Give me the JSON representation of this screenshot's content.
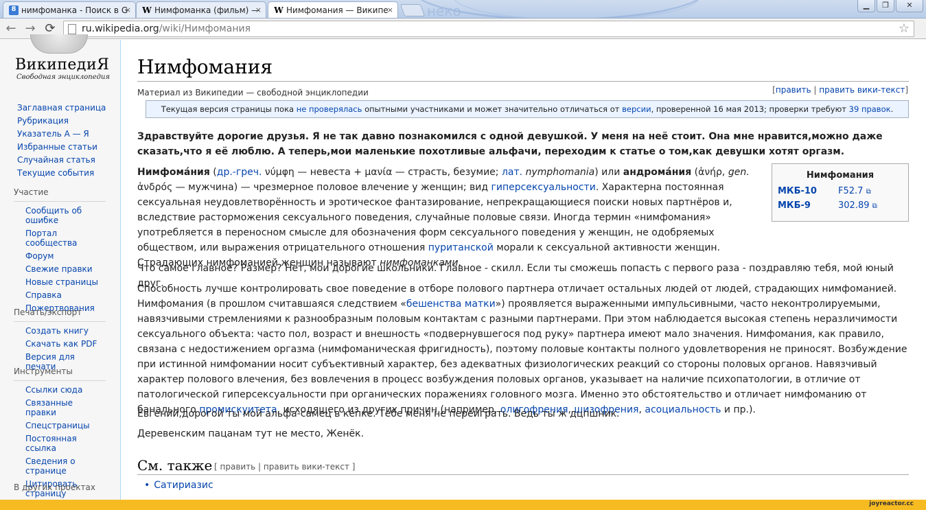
{
  "browser": {
    "tabs": [
      {
        "title": "нимфоманка - Поиск в G",
        "icon": "google-icon"
      },
      {
        "title": "Нимфоманка (фильм) —",
        "icon": "wikipedia-w-icon"
      },
      {
        "title": "Нимфомания — Википе",
        "icon": "wikipedia-w-icon"
      }
    ],
    "tab_icon_letters": {
      "google": "8",
      "wiki": "W"
    },
    "close_glyph": "×",
    "ghost_text": "неко",
    "window_buttons": {
      "minimize": "▁",
      "maximize": "❐",
      "close": "✕"
    },
    "url_host": "ru.wikipedia.org",
    "url_path": "/wiki/Нимфомания",
    "nav_icons": {
      "back": "←",
      "forward": "→",
      "reload": "⟳",
      "star": "☆"
    }
  },
  "wiki": {
    "logo_title": "ВикипедиЯ",
    "logo_subtitle": "Свободная энциклопедия",
    "nav_main": [
      "Заглавная страница",
      "Рубрикация",
      "Указатель А — Я",
      "Избранные статьи",
      "Случайная статья",
      "Текущие события"
    ],
    "portals": [
      {
        "heading": "Участие",
        "items": [
          "Сообщить об ошибке",
          "Портал сообщества",
          "Форум",
          "Свежие правки",
          "Новые страницы",
          "Справка",
          "Пожертвования"
        ]
      },
      {
        "heading": "Печать/экспорт",
        "items": [
          "Создать книгу",
          "Скачать как PDF",
          "Версия для печати"
        ]
      },
      {
        "heading": "Инструменты",
        "items": [
          "Ссылки сюда",
          "Связанные правки",
          "Спецстраницы",
          "Постоянная ссылка",
          "Сведения о странице",
          "Цитировать страницу"
        ]
      },
      {
        "heading": "В других проектах",
        "items": []
      }
    ]
  },
  "article": {
    "title": "Нимфомания",
    "from": "Материал из Википедии — свободной энциклопедии",
    "edit_links": {
      "open": "[",
      "edit": "править",
      "sep": " | ",
      "edit_source": "править вики-текст",
      "close": "]"
    },
    "notice": {
      "t1": "Текущая версия страницы пока ",
      "l1": "не проверялась",
      "t2": " опытными участниками и может значительно отличаться от ",
      "l2": "версии",
      "t3": ", проверенной 16 мая 2013; проверки требуют ",
      "l3": "39 правок",
      "t4": "."
    },
    "intro_bold": "Здравствуйте дорогие друзья. Я не так давно познакомился с одной девушкой. У меня на неё стоит. Она мне нравится,можно даже сказать,что я её люблю. А теперь,мои маленькие похотливые альфачи, переходим к статье о том,как девушки хотят оргазм.",
    "lead": {
      "term": "Нимфомáния",
      "t1": " (",
      "l1": "др.-греч.",
      "t2": " νύμφη — невеста + μανία — страсть, безумие; ",
      "l2": "лат.",
      "t3": " ",
      "i1": "nymphomania",
      "t4": ") или ",
      "term2": "андромáния",
      "t5": " (ἀνήρ, ",
      "i2": "gen.",
      "t6": " ἀνδρός — мужчина) — чрезмерное половое влечение у женщин; вид ",
      "l3": "гиперсексуальности",
      "t7": ". Характерна постоянная сексуальная неудовлетворённость и эротическое фантазирование, непрекращающиеся поиски новых партнёров и, вследствие расторможения сексуального поведения, случайные половые связи. Иногда термин «нимфомания» употребляется в переносном смысле для обозначения форм сексуального поведения у женщин, не одобряемых обществом, или выражения отрицательного отношения ",
      "l4": "пуританской",
      "t8": " морали к сексуальной активности женщин. Страдающих нимфоманией женщин называют ",
      "i3": "нимфоманками",
      "t9": "."
    },
    "para2": "Что самое главное? Размер? Нет, мои дорогие школьники. Главное - скилл. Если ты сможешь попасть с первого раза - поздравляю тебя, мой юный друг.",
    "para3": {
      "t1": "Способность лучше контролировать свое поведение в отборе полового партнера отличает остальных людей от людей, страдающих нимфоманией. Нимфомания (в прошлом считавшаяся следствием «",
      "l1": "бешенства матки",
      "t2": "») проявляется выраженными импульсивными, часто неконтролируемыми, навязчивыми стремлениями к разнообразным половым контактам с разными партнерами. При этом наблюдается высокая степень неразличимости сексуального объекта: часто пол, возраст и внешность «подвернувшегося под руку» партнера имеют мало значения. Нимфомания, как правило, связана с недостижением оргазма (нимфоманическая фригидность), поэтому половые контакты полного удовлетворения не приносят. Возбуждение при истинной нимфомании носит субъективный характер, без адекватных физиологических реакций со стороны половых органов. Навязчивый характер полового влечения, без вовлечения в процесс возбуждения половых органов, указывает на наличие психопатологии, в отличие от патологической гиперсексуальности при органических поражениях головного мозга. Именно это обстоятельство и отличает нимфоманию от банального ",
      "l2": "промискуитета",
      "t3": ", исходящего из других причин (например, ",
      "l3": "олигофрения",
      "t4": ", ",
      "l4": "шизофрения",
      "t5": ", ",
      "l5": "асоциальность",
      "t6": " и пр.)."
    },
    "para4": "Евгений,дорогой ты мой альфа-самец в кепке. Тебе меня не переиграть. Ведь ты ж дцпшник.",
    "para5": "Деревенским пацанам тут не место, Женёк.",
    "see_also": {
      "heading": "См. также",
      "edit": "[ править | править вики-текст ]",
      "bullet": "•",
      "items": [
        "Сатириазис"
      ]
    },
    "infobox": {
      "title": "Нимфомания",
      "ext_glyph": "⧉",
      "rows": [
        {
          "key": "МКБ-10",
          "value": "F52.7"
        },
        {
          "key": "МКБ-9",
          "value": "302.89"
        }
      ]
    }
  },
  "watermark": "joyreactor.cc"
}
